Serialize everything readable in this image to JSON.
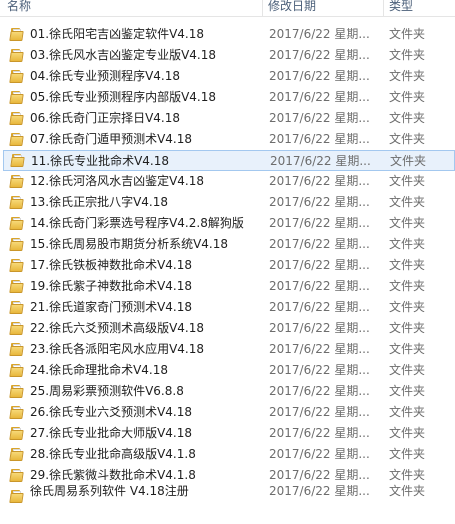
{
  "columns": {
    "name": "名称",
    "date": "修改日期",
    "type": "类型"
  },
  "rows": [
    {
      "name": "01.徐氏阳宅吉凶鉴定软件V4.18",
      "date": "2017/6/22 星期...",
      "type": "文件夹"
    },
    {
      "name": "03.徐氏风水吉凶鉴定专业版V4.18",
      "date": "2017/6/22 星期...",
      "type": "文件夹"
    },
    {
      "name": "04.徐氏专业预测程序V4.18",
      "date": "2017/6/22 星期...",
      "type": "文件夹"
    },
    {
      "name": "05.徐氏专业预测程序内部版V4.18",
      "date": "2017/6/22 星期...",
      "type": "文件夹"
    },
    {
      "name": "06.徐氏奇门正宗择日V4.18",
      "date": "2017/6/22 星期...",
      "type": "文件夹"
    },
    {
      "name": "07.徐氏奇门遁甲预测术V4.18",
      "date": "2017/6/22 星期...",
      "type": "文件夹"
    },
    {
      "name": "11.徐氏专业批命术V4.18",
      "date": "2017/6/22 星期...",
      "type": "文件夹"
    },
    {
      "name": "12.徐氏河洛风水吉凶鉴定V4.18",
      "date": "2017/6/22 星期...",
      "type": "文件夹"
    },
    {
      "name": "13.徐氏正宗批八字V4.18",
      "date": "2017/6/22 星期...",
      "type": "文件夹"
    },
    {
      "name": "14.徐氏奇门彩票选号程序V4.2.8解狗版",
      "date": "2017/6/22 星期...",
      "type": "文件夹"
    },
    {
      "name": "15.徐氏周易股市期货分析系统V4.18",
      "date": "2017/6/22 星期...",
      "type": "文件夹"
    },
    {
      "name": "17.徐氏铁板神数批命术V4.18",
      "date": "2017/6/22 星期...",
      "type": "文件夹"
    },
    {
      "name": "19.徐氏紫子神数批命术V4.18",
      "date": "2017/6/22 星期...",
      "type": "文件夹"
    },
    {
      "name": "21.徐氏道家奇门预测术V4.18",
      "date": "2017/6/22 星期...",
      "type": "文件夹"
    },
    {
      "name": "22.徐氏六爻预测术高级版V4.18",
      "date": "2017/6/22 星期...",
      "type": "文件夹"
    },
    {
      "name": "23.徐氏各派阳宅风水应用V4.18",
      "date": "2017/6/22 星期...",
      "type": "文件夹"
    },
    {
      "name": "24.徐氏命理批命术V4.18",
      "date": "2017/6/22 星期...",
      "type": "文件夹"
    },
    {
      "name": "25.周易彩票预测软件V6.8.8",
      "date": "2017/6/22 星期...",
      "type": "文件夹"
    },
    {
      "name": "26.徐氏专业六爻预测术V4.18",
      "date": "2017/6/22 星期...",
      "type": "文件夹"
    },
    {
      "name": "27.徐氏专业批命大师版V4.18",
      "date": "2017/6/22 星期...",
      "type": "文件夹"
    },
    {
      "name": "28.徐氏专业批命高级版V4.1.8",
      "date": "2017/6/22 星期...",
      "type": "文件夹"
    },
    {
      "name": "29.徐氏紫微斗数批命术V4.1.8",
      "date": "2017/6/22 星期...",
      "type": "文件夹"
    },
    {
      "name": "徐氏周易系列软件 V4.18注册",
      "date": "2017/6/22 星期...",
      "type": "文件夹"
    }
  ],
  "hover_row_index": 6
}
